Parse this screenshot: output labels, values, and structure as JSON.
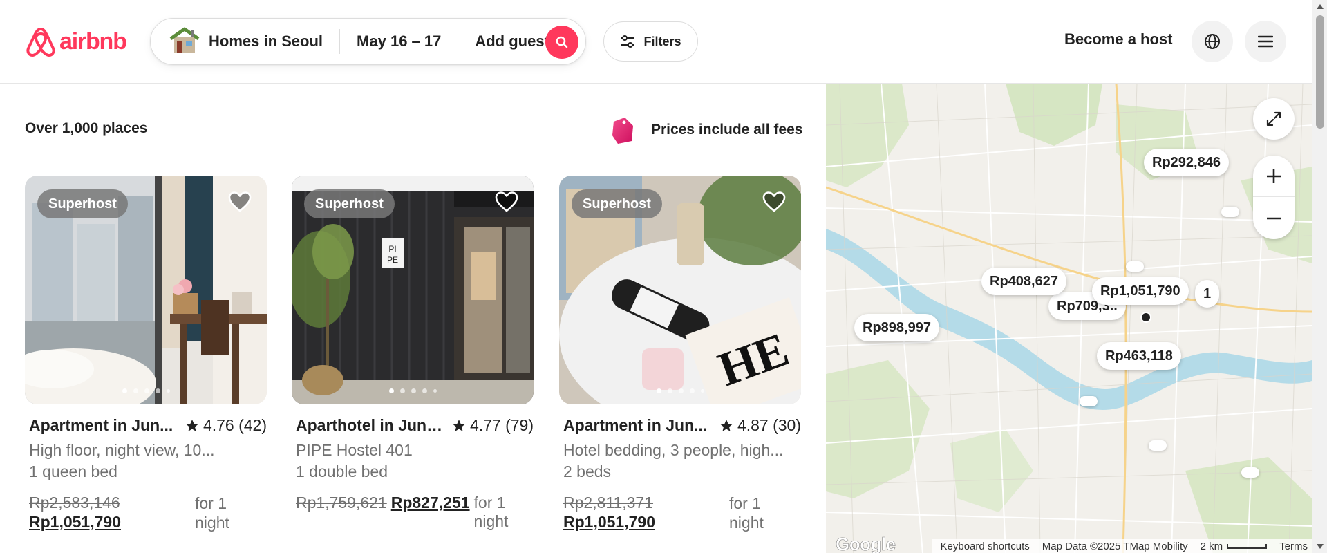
{
  "brand": {
    "name": "airbnb",
    "color": "#FF385C"
  },
  "search": {
    "location": "Homes in Seoul",
    "dates": "May 16 – 17",
    "guests": "Add guests"
  },
  "toolbar": {
    "filters_label": "Filters"
  },
  "nav": {
    "host_label": "Become a host",
    "globe_icon": "globe-icon",
    "menu_icon": "menu-icon"
  },
  "results": {
    "count": "Over 1,000 places",
    "fees_note": "Prices include all fees"
  },
  "listings": [
    {
      "badge": "Superhost",
      "title": "Apartment in Jun...",
      "rating": "4.76 (42)",
      "subtitle": "High floor, night view, 10...",
      "beds": "1 queen bed",
      "price_old": "Rp2,583,146",
      "price_new": "Rp1,051,790",
      "price_period": "for 1 night"
    },
    {
      "badge": "Superhost",
      "title": "Aparthotel in Jung...",
      "rating": "4.77 (79)",
      "subtitle": "PIPE Hostel 401",
      "beds": "1 double bed",
      "price_old": "Rp1,759,621",
      "price_new": "Rp827,251",
      "price_period": "for 1 night"
    },
    {
      "badge": "Superhost",
      "title": "Apartment in Jun...",
      "rating": "4.87 (30)",
      "subtitle": "Hotel bedding, 3 people, high...",
      "beds": "2 beds",
      "price_old": "Rp2,811,371",
      "price_new": "Rp1,051,790",
      "price_period": "for 1 night"
    }
  ],
  "map": {
    "pins": [
      "Rp292,846",
      "Rp408,627",
      "Rp1,051,790",
      "Rp709,3..",
      "1",
      "Rp898,997",
      "Rp463,118"
    ],
    "google_label": "Google",
    "keyboard_shortcuts": "Keyboard shortcuts",
    "map_data": "Map Data ©2025 TMap Mobility",
    "scale": "2 km",
    "terms": "Terms"
  }
}
